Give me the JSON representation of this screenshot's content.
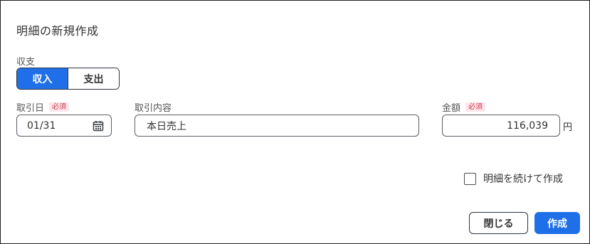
{
  "dialog": {
    "title": "明細の新規作成"
  },
  "type_toggle": {
    "label": "収支",
    "options": [
      "収入",
      "支出"
    ],
    "selected": "収入"
  },
  "date": {
    "label": "取引日",
    "required_badge": "必須",
    "value": "01/31",
    "icon": "calendar-icon"
  },
  "description": {
    "label": "取引内容",
    "value": "本日売上"
  },
  "amount": {
    "label": "金額",
    "required_badge": "必須",
    "value": "116,039",
    "unit": "円"
  },
  "continue_checkbox": {
    "label": "明細を続けて作成",
    "checked": false
  },
  "buttons": {
    "close": "閉じる",
    "create": "作成"
  },
  "colors": {
    "accent": "#1f70e8",
    "required_bg": "#fde7ec",
    "required_text": "#d4354b",
    "border": "#2d3540"
  }
}
